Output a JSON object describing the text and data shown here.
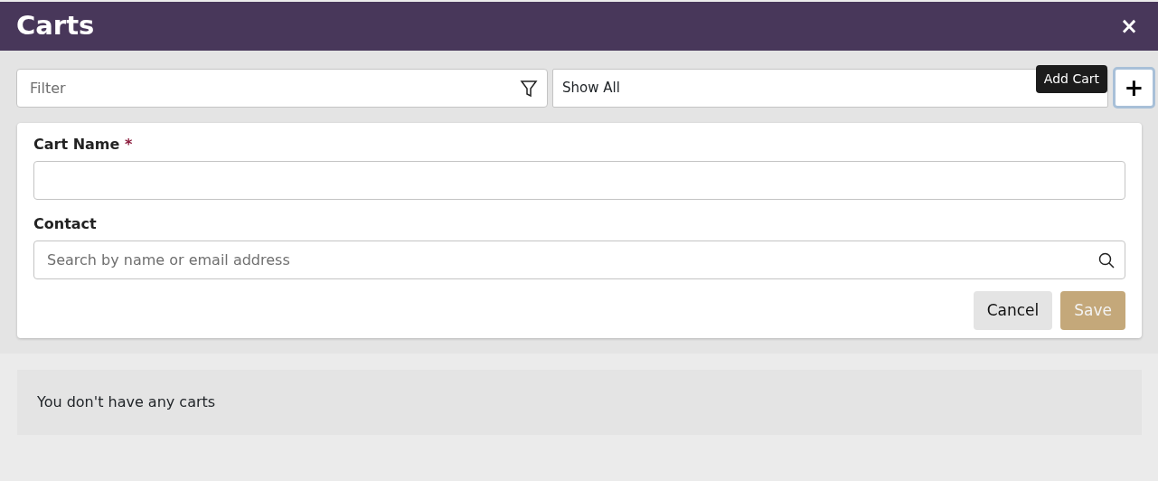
{
  "window": {
    "title": "Carts",
    "close": "×"
  },
  "toolbar": {
    "filter": {
      "placeholder": "Filter"
    },
    "show": {
      "value": "Show All"
    },
    "add_button": {
      "label": "+",
      "focused": true,
      "tooltip": "Add Cart"
    }
  },
  "form": {
    "fields": [
      {
        "kind": "text",
        "label": "Cart Name",
        "required_mark": "*"
      },
      {
        "kind": "search",
        "label": "Contact",
        "placeholder": "Search by name or email address"
      }
    ],
    "buttons": [
      {
        "kind": "secondary",
        "label": "Cancel"
      },
      {
        "kind": "primary",
        "label": "Save",
        "disabled": true
      }
    ]
  },
  "empty_message": "You don't have any carts"
}
